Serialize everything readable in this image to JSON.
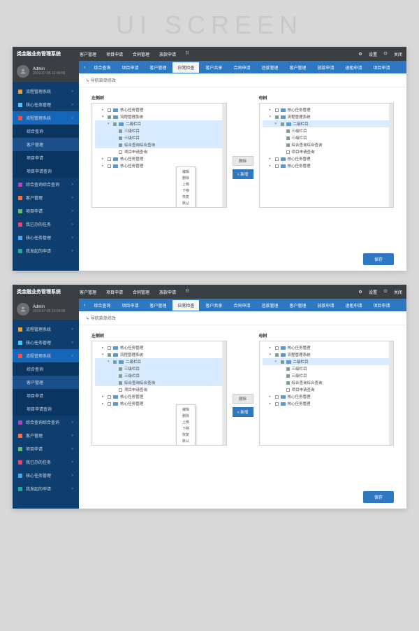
{
  "page_heading": "UI SCREEN",
  "app": {
    "name": "类金融业务管理系统",
    "top_nav": [
      "客户管理",
      "项目申请",
      "合同管理",
      "放款申请"
    ],
    "settings": "设置",
    "close": "关闭",
    "user": {
      "name": "Admin",
      "date": "2019-07-05 12:09:06"
    }
  },
  "sidebar": {
    "items": [
      {
        "label": "流程管理系统",
        "color": "#f0a030",
        "chev": ">"
      },
      {
        "label": "核心任务管理",
        "color": "#4fc3f7",
        "chev": ">"
      },
      {
        "label": "流程管理系统",
        "color": "#ef5350",
        "chev": "v",
        "active": true
      },
      {
        "label": "综合查询",
        "sub": true
      },
      {
        "label": "客户管理",
        "sub": true,
        "sel": true
      },
      {
        "label": "项目申请",
        "sub": true
      },
      {
        "label": "项目申请查询",
        "sub": true
      },
      {
        "label": "综合查询综合查询",
        "color": "#ab47bc",
        "chev": ">"
      },
      {
        "label": "客户管理",
        "color": "#ff7043",
        "chev": ">"
      },
      {
        "label": "项目申请",
        "color": "#66bb6a",
        "chev": ">"
      },
      {
        "label": "我已办的任务",
        "color": "#ec407a",
        "chev": ">"
      },
      {
        "label": "核心任务管理",
        "color": "#42a5f5",
        "chev": ">"
      },
      {
        "label": "我发起的申请",
        "color": "#26a69a",
        "chev": ">"
      }
    ]
  },
  "tabs": {
    "items": [
      "综合查询",
      "项目申请",
      "客户管理",
      "日常检查",
      "客户共享",
      "合同申请",
      "还款管理",
      "客户管理",
      "放款申请",
      "退租申请",
      "项目申请"
    ],
    "active_index": 3
  },
  "breadcrumb": "导航菜单修改",
  "trees": {
    "left_title": "左侧树",
    "right_title": "母树",
    "left": [
      {
        "label": "核心任务管理",
        "ind": 1,
        "fold": true,
        "tog": "▸"
      },
      {
        "label": "流程管理系统",
        "ind": 1,
        "fold": true,
        "tog": "▾",
        "ck": true
      },
      {
        "label": "二级栏目",
        "ind": 2,
        "fold": true,
        "tog": "▾",
        "ck": true,
        "hl": true
      },
      {
        "label": "三级栏目",
        "ind": 3,
        "ck": true,
        "hl": true
      },
      {
        "label": "三级栏目",
        "ind": 3,
        "ck": true,
        "hl": true
      },
      {
        "label": "综合查询综合查询",
        "ind": 3,
        "ck": true,
        "hl": true
      },
      {
        "label": "项目申请查询",
        "ind": 3
      },
      {
        "label": "核心任务管理",
        "ind": 1,
        "fold": true,
        "tog": "▸"
      },
      {
        "label": "核心任务管理",
        "ind": 1,
        "fold": true,
        "tog": "▸"
      }
    ],
    "right": [
      {
        "label": "核心任务管理",
        "ind": 1,
        "fold": true,
        "tog": "▸"
      },
      {
        "label": "流程管理系统",
        "ind": 1,
        "fold": true,
        "tog": "▾",
        "ck": true
      },
      {
        "label": "二级栏目",
        "ind": 2,
        "fold": true,
        "tog": "▾",
        "ck": true,
        "hl": true
      },
      {
        "label": "三级栏目",
        "ind": 3,
        "ck": true
      },
      {
        "label": "三级栏目",
        "ind": 3,
        "ck": true
      },
      {
        "label": "综合查询综合查询",
        "ind": 3,
        "ck": true
      },
      {
        "label": "项目申请查询",
        "ind": 3
      },
      {
        "label": "核心任务管理",
        "ind": 1,
        "fold": true,
        "tog": "▸"
      },
      {
        "label": "核心任务管理",
        "ind": 1,
        "fold": true,
        "tog": "▸"
      }
    ]
  },
  "context_menu": [
    "编辑",
    "删除",
    "上移",
    "下移",
    "恢复",
    "默认"
  ],
  "mid_buttons": {
    "delete": "删除",
    "add": "< 新增"
  },
  "save": "保存"
}
